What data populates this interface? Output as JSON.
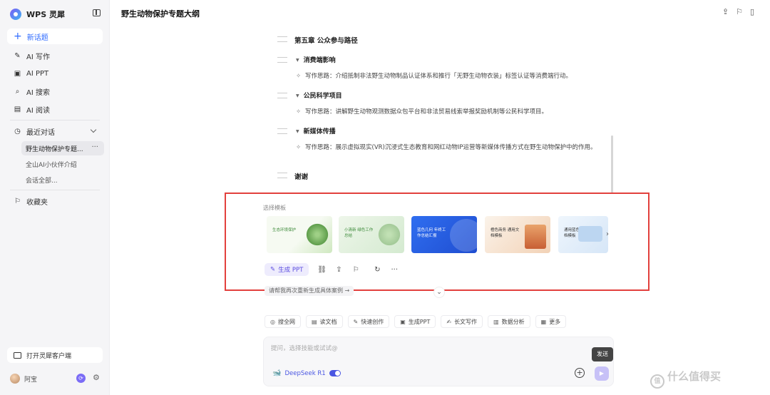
{
  "app": {
    "name": "WPS 灵犀"
  },
  "sidebar": {
    "new_chat": "新话题",
    "items": [
      {
        "label": "AI 写作",
        "icon": "pen-icon"
      },
      {
        "label": "AI PPT",
        "icon": "ppt-icon"
      },
      {
        "label": "AI 搜索",
        "icon": "search-icon"
      },
      {
        "label": "AI 阅读",
        "icon": "book-icon"
      }
    ],
    "recent_label": "最近对话",
    "history": [
      "野生动物保护专题...",
      "全山AI小伙伴介绍",
      "会话全部..."
    ],
    "favorites_label": "收藏夹",
    "open_client": "打开灵犀客户端",
    "user_name": "阿宝"
  },
  "document": {
    "title": "野生动物保护专题大纲",
    "chapter": "第五章 公众参与路径",
    "sections": [
      {
        "title": "消费端影响",
        "note": "写作思路：介绍抵制非法野生动物制品认证体系和推行「无野生动物衣装」标签认证等消费端行动。"
      },
      {
        "title": "公民科学项目",
        "note": "写作思路：讲解野生动物观测数据众包平台和非法贸易线索举报奖励机制等公民科学项目。"
      },
      {
        "title": "新媒体传播",
        "note": "写作思路：展示虚拟现实(VR)沉浸式生态教育和网红动物IP运营等新媒体传播方式在野生动物保护中的作用。"
      }
    ],
    "thanks": "谢谢"
  },
  "templates": {
    "label": "选择模板",
    "items": [
      {
        "text": "生态环境保护"
      },
      {
        "text": "小清新 绿色工作总结"
      },
      {
        "text": "蓝色几何 年终工作总结汇报"
      },
      {
        "text": "橙色商务 通用文档模板"
      },
      {
        "text": "通用蓝色 商务文档模板"
      }
    ]
  },
  "actions": {
    "generate_ppt": "生成 PPT"
  },
  "suggestion": "请帮我再次重新生成具体案例 →",
  "skills": [
    {
      "label": "搜全网",
      "icon": "globe-icon"
    },
    {
      "label": "读文档",
      "icon": "doc-icon"
    },
    {
      "label": "快速创作",
      "icon": "pen-icon"
    },
    {
      "label": "生成PPT",
      "icon": "ppt-icon"
    },
    {
      "label": "长文写作",
      "icon": "longtext-icon"
    },
    {
      "label": "数据分析",
      "icon": "chart-icon"
    },
    {
      "label": "更多",
      "icon": "grid-icon"
    }
  ],
  "input": {
    "placeholder": "提问，选择技能或试试@",
    "model": "DeepSeek R1",
    "send_tooltip": "发送"
  },
  "watermark": "什么值得买"
}
